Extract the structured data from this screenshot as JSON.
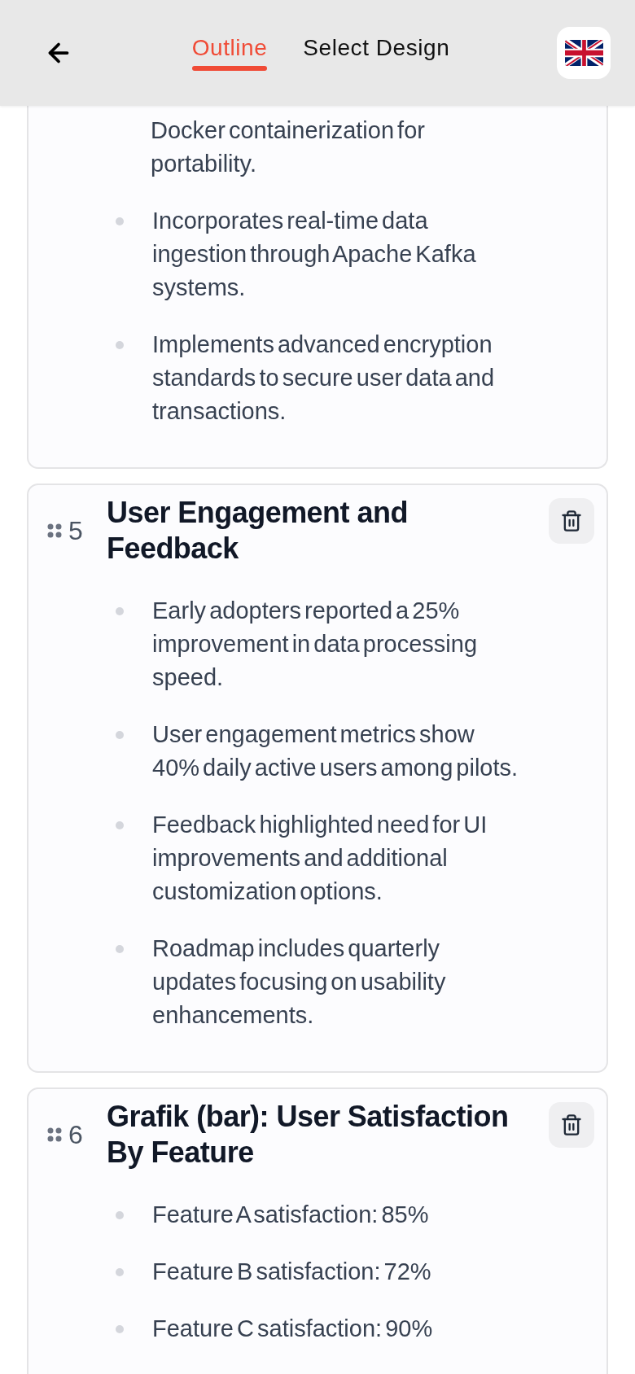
{
  "header": {
    "tabs": [
      {
        "label": "Outline",
        "selected": true
      },
      {
        "label": "Select Design",
        "selected": false
      }
    ]
  },
  "slides": [
    {
      "kind": "partial",
      "continued_text": "Docker containerization for portability.",
      "bullets": [
        "Incorporates real-time data ingestion through Apache Kafka systems.",
        "Implements advanced encryption standards to secure user data and transactions."
      ]
    },
    {
      "kind": "full",
      "number": "5",
      "title": "User Engagement and Feedback",
      "bullets": [
        "Early adopters reported a 25% improvement in data processing speed.",
        "User engagement metrics show 40% daily active users among pilots.",
        "Feedback highlighted need for UI improvements and additional customization options.",
        "Roadmap includes quarterly updates focusing on usability enhancements."
      ]
    },
    {
      "kind": "full",
      "number": "6",
      "title": "Grafik (bar): User Satisfaction By Feature",
      "bullets": [
        "Feature A satisfaction: 85%",
        "Feature B satisfaction: 72%",
        "Feature C satisfaction: 90%"
      ]
    }
  ]
}
